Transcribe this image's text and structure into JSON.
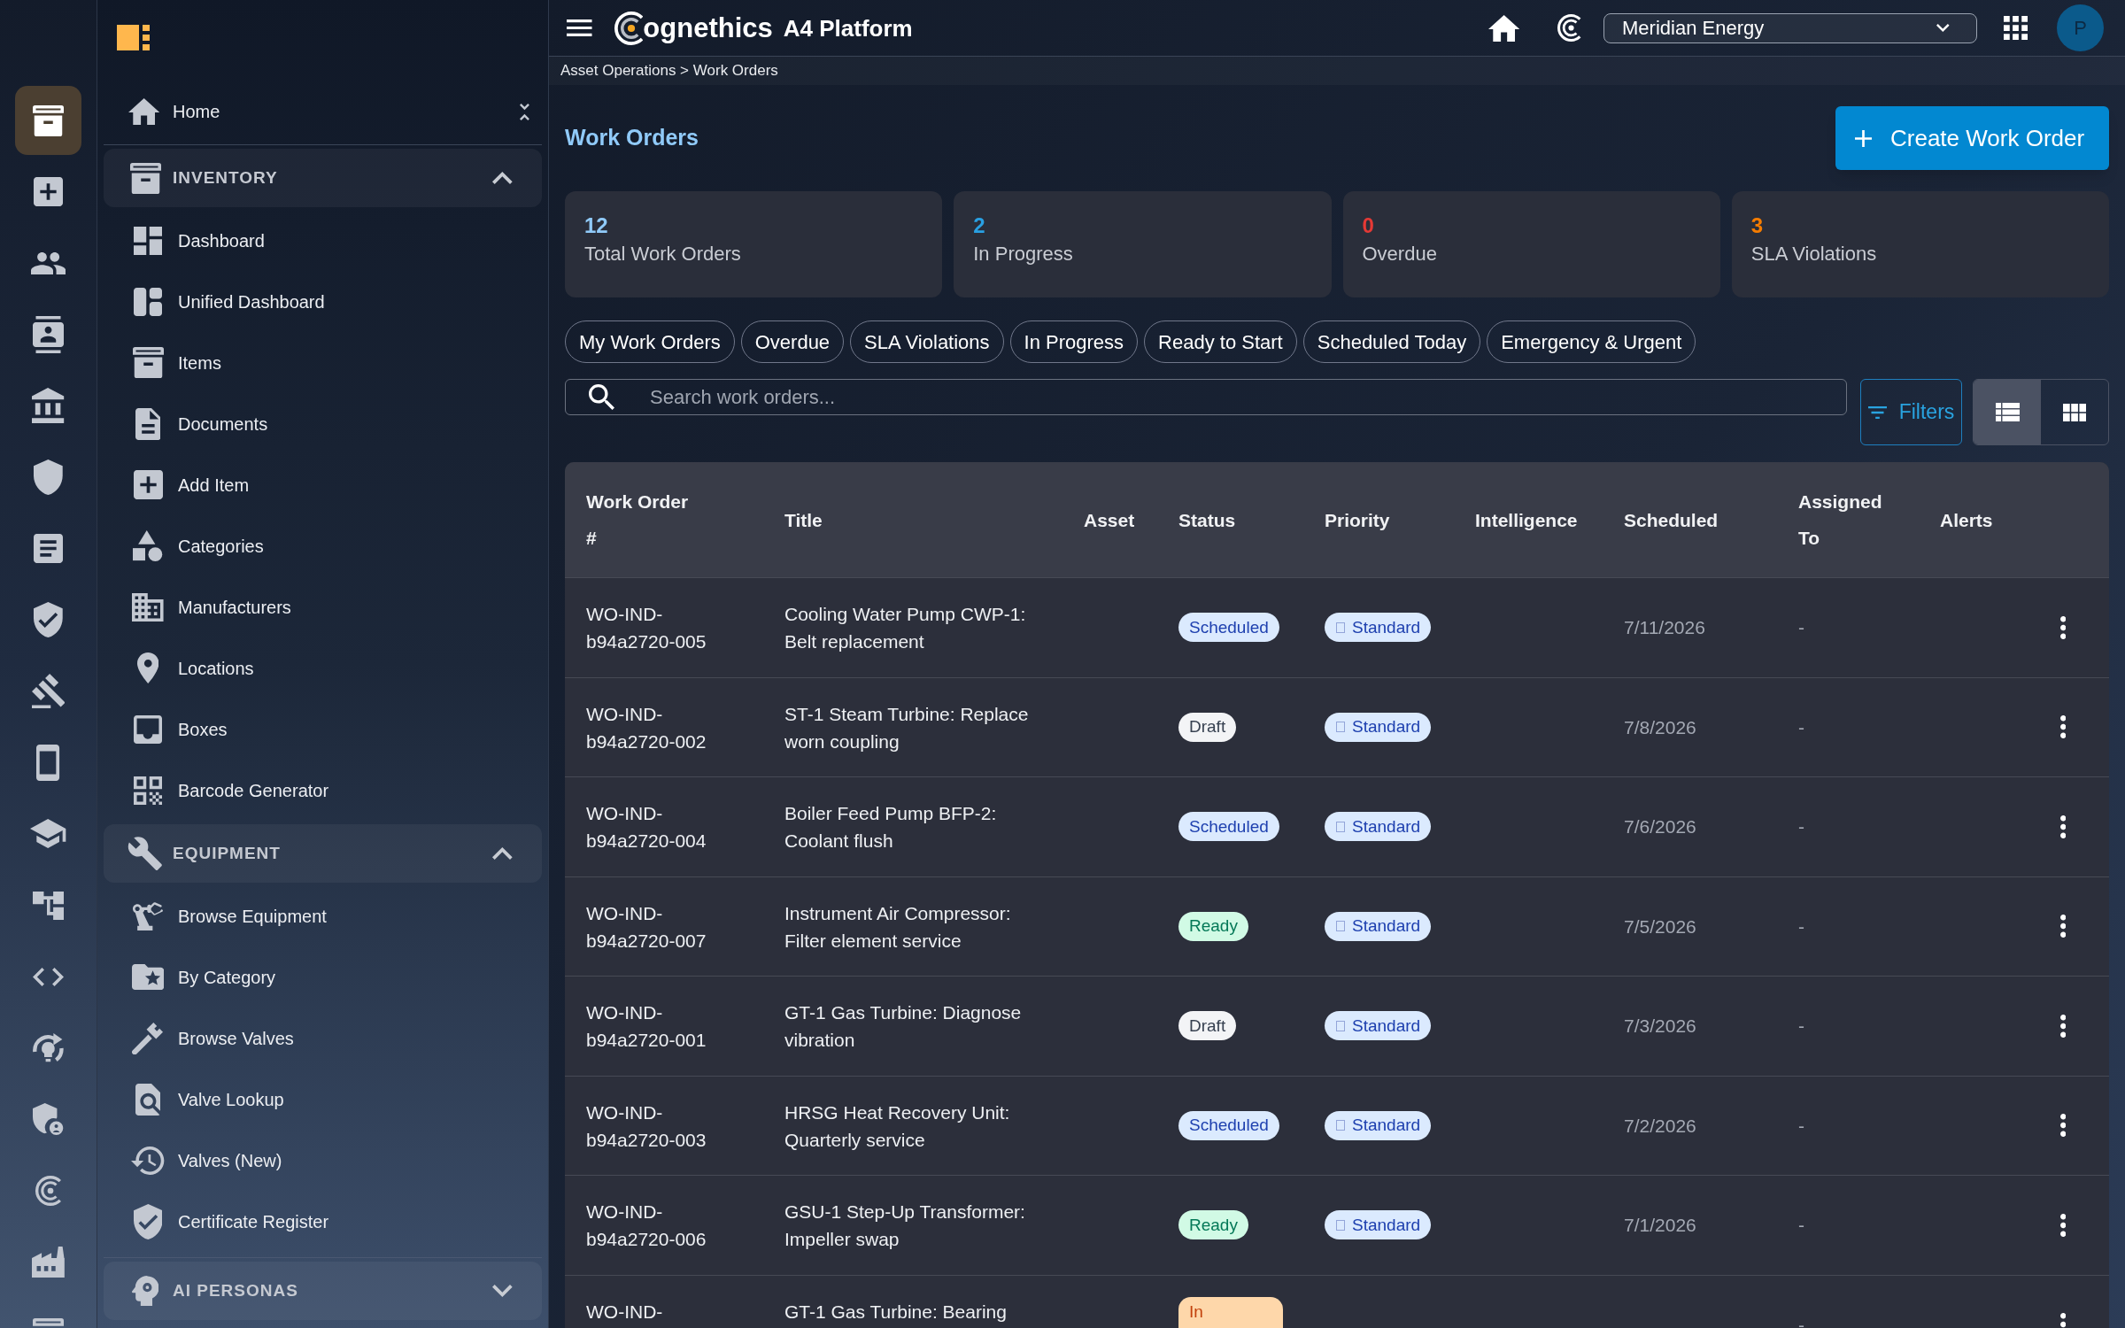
{
  "rail": [
    {
      "selected": true
    },
    {
      "selected": false
    },
    {
      "selected": false
    },
    {
      "selected": false
    },
    {
      "selected": false
    },
    {
      "selected": false
    },
    {
      "selected": false
    },
    {
      "selected": false
    },
    {
      "selected": false
    },
    {
      "selected": false
    },
    {
      "selected": false
    },
    {
      "selected": false
    },
    {
      "selected": false
    },
    {
      "selected": false
    },
    {
      "selected": false
    },
    {
      "selected": false
    },
    {
      "selected": false
    },
    {
      "selected": false
    }
  ],
  "sidebar": {
    "home": {
      "label": "Home",
      "selected": false
    },
    "sections": [
      {
        "title": "INVENTORY",
        "expanded": true,
        "items": [
          {
            "label": "Dashboard",
            "selected": false
          },
          {
            "label": "Unified Dashboard",
            "selected": false
          },
          {
            "label": "Items",
            "selected": false
          },
          {
            "label": "Documents",
            "selected": false
          },
          {
            "label": "Add Item",
            "selected": false
          },
          {
            "label": "Categories",
            "selected": false
          },
          {
            "label": "Manufacturers",
            "selected": false
          },
          {
            "label": "Locations",
            "selected": false
          },
          {
            "label": "Boxes",
            "selected": false
          },
          {
            "label": "Barcode Generator",
            "selected": false
          }
        ]
      },
      {
        "title": "EQUIPMENT",
        "expanded": true,
        "items": [
          {
            "label": "Browse Equipment",
            "selected": false
          },
          {
            "label": "By Category",
            "selected": false
          },
          {
            "label": "Browse Valves",
            "selected": false
          },
          {
            "label": "Valve Lookup",
            "selected": false
          },
          {
            "label": "Valves (New)",
            "selected": false
          },
          {
            "label": "Certificate Register",
            "selected": false
          }
        ]
      },
      {
        "title": "AI PERSONAS",
        "expanded": false
      }
    ]
  },
  "topbar": {
    "brand": "ognethics",
    "product": "A4 Platform",
    "organization": "Meridian Energy",
    "avatar": "P"
  },
  "breadcrumb": "Asset Operations > Work Orders",
  "page": {
    "title": "Work Orders",
    "create_button": "Create Work Order"
  },
  "stats": [
    {
      "value": "12",
      "label": "Total Work Orders",
      "color": "#90caf9"
    },
    {
      "value": "2",
      "label": "In Progress",
      "color": "#29a0e2"
    },
    {
      "value": "0",
      "label": "Overdue",
      "color": "#e53935"
    },
    {
      "value": "3",
      "label": "SLA Violations",
      "color": "#f57c00"
    }
  ],
  "quick_filters": [
    {
      "label": "My Work Orders",
      "selected": false
    },
    {
      "label": "Overdue",
      "selected": false
    },
    {
      "label": "SLA Violations",
      "selected": false
    },
    {
      "label": "In Progress",
      "selected": false
    },
    {
      "label": "Ready to Start",
      "selected": false
    },
    {
      "label": "Scheduled Today",
      "selected": false
    },
    {
      "label": "Emergency & Urgent",
      "selected": false
    }
  ],
  "search": {
    "placeholder": "Search work orders..."
  },
  "filters_button": "Filters",
  "view_toggle": [
    {
      "kind": "list",
      "selected": true
    },
    {
      "kind": "grid",
      "selected": false
    }
  ],
  "table": {
    "columns": [
      "Work Order #",
      "Title",
      "Asset",
      "Status",
      "Priority",
      "Intelligence",
      "Scheduled",
      "Assigned To",
      "Alerts"
    ],
    "rows": [
      {
        "work_order": "WO-IND-b94a2720-005",
        "title": "Cooling Water Pump CWP-1: Belt replacement",
        "status": {
          "label": "Scheduled",
          "kind": "scheduled"
        },
        "priority": "Standard",
        "scheduled": "7/11/2026",
        "assigned_to": "-"
      },
      {
        "work_order": "WO-IND-b94a2720-002",
        "title": "ST-1 Steam Turbine: Replace worn coupling",
        "status": {
          "label": "Draft",
          "kind": "draft"
        },
        "priority": "Standard",
        "scheduled": "7/8/2026",
        "assigned_to": "-"
      },
      {
        "work_order": "WO-IND-b94a2720-004",
        "title": "Boiler Feed Pump BFP-2: Coolant flush",
        "status": {
          "label": "Scheduled",
          "kind": "scheduled"
        },
        "priority": "Standard",
        "scheduled": "7/6/2026",
        "assigned_to": "-"
      },
      {
        "work_order": "WO-IND-b94a2720-007",
        "title": "Instrument Air Compressor: Filter element service",
        "status": {
          "label": "Ready",
          "kind": "ready"
        },
        "priority": "Standard",
        "scheduled": "7/5/2026",
        "assigned_to": "-"
      },
      {
        "work_order": "WO-IND-b94a2720-001",
        "title": "GT-1 Gas Turbine: Diagnose vibration",
        "status": {
          "label": "Draft",
          "kind": "draft"
        },
        "priority": "Standard",
        "scheduled": "7/3/2026",
        "assigned_to": "-"
      },
      {
        "work_order": "WO-IND-b94a2720-003",
        "title": "HRSG Heat Recovery Unit: Quarterly service",
        "status": {
          "label": "Scheduled",
          "kind": "scheduled"
        },
        "priority": "Standard",
        "scheduled": "7/2/2026",
        "assigned_to": "-"
      },
      {
        "work_order": "WO-IND-b94a2720-006",
        "title": "GSU-1 Step-Up Transformer: Impeller swap",
        "status": {
          "label": "Ready",
          "kind": "ready"
        },
        "priority": "Standard",
        "scheduled": "7/1/2026",
        "assigned_to": "-"
      },
      {
        "work_order": "WO-IND-",
        "title": "GT-1 Gas Turbine: Bearing",
        "status": {
          "label": "In",
          "kind": "in_progress"
        },
        "assigned_to": "-"
      }
    ]
  }
}
